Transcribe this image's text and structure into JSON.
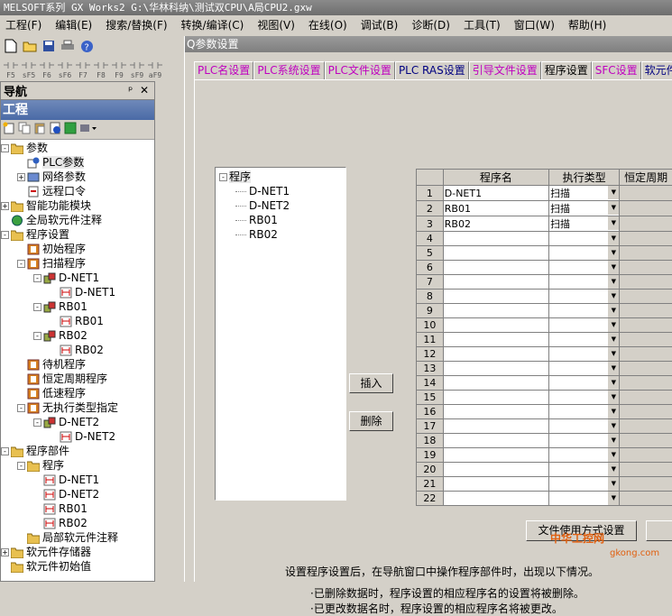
{
  "window_title": "MELSOFT系列 GX Works2 G:\\华林科纳\\测试双CPU\\A局CPU2.gxw",
  "menu": [
    "工程(F)",
    "编辑(E)",
    "搜索/替换(F)",
    "转换/编译(C)",
    "视图(V)",
    "在线(O)",
    "调试(B)",
    "诊断(D)",
    "工具(T)",
    "窗口(W)",
    "帮助(H)"
  ],
  "fkeys": [
    "F5",
    "sF5",
    "F6",
    "sF6",
    "F7",
    "F8",
    "F9",
    "sF9",
    "aF9"
  ],
  "nav": {
    "header": "导航",
    "pin": "ᵖ",
    "close": "✕",
    "title": "工程",
    "tree": [
      {
        "label": "参数",
        "level": 0,
        "exp": "-",
        "icon": "folder"
      },
      {
        "label": "PLC参数",
        "level": 1,
        "exp": "",
        "icon": "gear",
        "selected": true
      },
      {
        "label": "网络参数",
        "level": 1,
        "exp": "+",
        "icon": "net"
      },
      {
        "label": "远程口令",
        "level": 1,
        "exp": "",
        "icon": "doc"
      },
      {
        "label": "智能功能模块",
        "level": 0,
        "exp": "+",
        "icon": "folder"
      },
      {
        "label": "全局软元件注释",
        "level": 0,
        "exp": "",
        "icon": "globe"
      },
      {
        "label": "程序设置",
        "level": 0,
        "exp": "-",
        "icon": "folder"
      },
      {
        "label": "初始程序",
        "level": 1,
        "exp": "",
        "icon": "prog"
      },
      {
        "label": "扫描程序",
        "level": 1,
        "exp": "-",
        "icon": "prog"
      },
      {
        "label": "D-NET1",
        "level": 2,
        "exp": "-",
        "icon": "task"
      },
      {
        "label": "D-NET1",
        "level": 3,
        "exp": "",
        "icon": "ld"
      },
      {
        "label": "RB01",
        "level": 2,
        "exp": "-",
        "icon": "task"
      },
      {
        "label": "RB01",
        "level": 3,
        "exp": "",
        "icon": "ld"
      },
      {
        "label": "RB02",
        "level": 2,
        "exp": "-",
        "icon": "task"
      },
      {
        "label": "RB02",
        "level": 3,
        "exp": "",
        "icon": "ld"
      },
      {
        "label": "待机程序",
        "level": 1,
        "exp": "",
        "icon": "prog"
      },
      {
        "label": "恒定周期程序",
        "level": 1,
        "exp": "",
        "icon": "prog"
      },
      {
        "label": "低速程序",
        "level": 1,
        "exp": "",
        "icon": "prog"
      },
      {
        "label": "无执行类型指定",
        "level": 1,
        "exp": "-",
        "icon": "prog"
      },
      {
        "label": "D-NET2",
        "level": 2,
        "exp": "-",
        "icon": "task"
      },
      {
        "label": "D-NET2",
        "level": 3,
        "exp": "",
        "icon": "ld"
      },
      {
        "label": "程序部件",
        "level": 0,
        "exp": "-",
        "icon": "folder"
      },
      {
        "label": "程序",
        "level": 1,
        "exp": "-",
        "icon": "folder"
      },
      {
        "label": "D-NET1",
        "level": 2,
        "exp": "",
        "icon": "ld"
      },
      {
        "label": "D-NET2",
        "level": 2,
        "exp": "",
        "icon": "ld"
      },
      {
        "label": "RB01",
        "level": 2,
        "exp": "",
        "icon": "ld"
      },
      {
        "label": "RB02",
        "level": 2,
        "exp": "",
        "icon": "ld"
      },
      {
        "label": "局部软元件注释",
        "level": 1,
        "exp": "",
        "icon": "folder"
      },
      {
        "label": "软元件存储器",
        "level": 0,
        "exp": "+",
        "icon": "folder"
      },
      {
        "label": "软元件初始值",
        "level": 0,
        "exp": "",
        "icon": "folder"
      }
    ]
  },
  "dialog": {
    "title": "Q参数设置",
    "tabs": [
      {
        "label": "PLC名设置",
        "style": "pink"
      },
      {
        "label": "PLC系统设置",
        "style": "pink"
      },
      {
        "label": "PLC文件设置",
        "style": "pink"
      },
      {
        "label": "PLC RAS设置",
        "style": "navy"
      },
      {
        "label": "引导文件设置",
        "style": "pink"
      },
      {
        "label": "程序设置",
        "style": "active"
      },
      {
        "label": "SFC设置",
        "style": "pink"
      },
      {
        "label": "软元件",
        "style": "navy"
      }
    ],
    "program_tree": {
      "root": "程序",
      "items": [
        "D-NET1",
        "D-NET2",
        "RB01",
        "RB02"
      ]
    },
    "insert_button": "插入",
    "delete_button": "删除",
    "table": {
      "headers": [
        "程序名",
        "执行类型",
        "恒定周期"
      ],
      "rows": [
        {
          "no": "1",
          "name": "D-NET1",
          "type": "扫描"
        },
        {
          "no": "2",
          "name": "RB01",
          "type": "扫描"
        },
        {
          "no": "3",
          "name": "RB02",
          "type": "扫描"
        },
        {
          "no": "4",
          "name": "",
          "type": ""
        },
        {
          "no": "5",
          "name": "",
          "type": ""
        },
        {
          "no": "6",
          "name": "",
          "type": ""
        },
        {
          "no": "7",
          "name": "",
          "type": ""
        },
        {
          "no": "8",
          "name": "",
          "type": ""
        },
        {
          "no": "9",
          "name": "",
          "type": ""
        },
        {
          "no": "10",
          "name": "",
          "type": ""
        },
        {
          "no": "11",
          "name": "",
          "type": ""
        },
        {
          "no": "12",
          "name": "",
          "type": ""
        },
        {
          "no": "13",
          "name": "",
          "type": ""
        },
        {
          "no": "14",
          "name": "",
          "type": ""
        },
        {
          "no": "15",
          "name": "",
          "type": ""
        },
        {
          "no": "16",
          "name": "",
          "type": ""
        },
        {
          "no": "17",
          "name": "",
          "type": ""
        },
        {
          "no": "18",
          "name": "",
          "type": ""
        },
        {
          "no": "19",
          "name": "",
          "type": ""
        },
        {
          "no": "20",
          "name": "",
          "type": ""
        },
        {
          "no": "21",
          "name": "",
          "type": ""
        },
        {
          "no": "22",
          "name": "",
          "type": ""
        }
      ]
    },
    "file_usage_button": "文件使用方式设置",
    "notes": [
      "设置程序设置后，在导航窗口中操作程序部件时，出现以下情况。",
      "·已删除数据时，程序设置的相应程序名的设置将被删除。",
      "·已更改数据名时，程序设置的相应程序名将被更改。"
    ]
  },
  "watermark": {
    "text": "中华工控网",
    "sub": "gkong.com"
  }
}
